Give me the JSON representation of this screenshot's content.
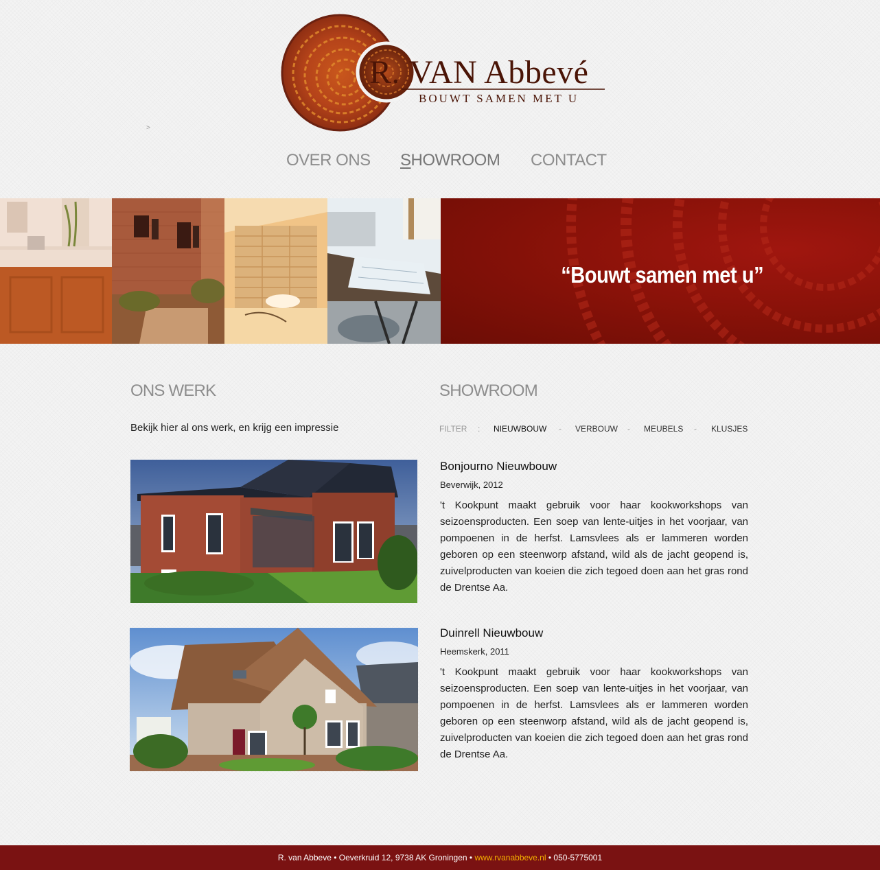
{
  "brand": {
    "logo_initial": "R.",
    "logo_name": "VAN Abbevé",
    "tagline": "BOUWT SAMEN MET U",
    "colors": {
      "primary": "#7a1212",
      "accent": "#f5b100",
      "logo_brown": "#4a1406"
    }
  },
  "breadcrumb": ">",
  "nav": {
    "items": [
      {
        "label": "OVER ONS",
        "underlined": "",
        "rest": "OVER ONS",
        "active": false
      },
      {
        "label": "SHOWROOM",
        "underlined": "S",
        "rest": "HOWROOM",
        "active": true
      },
      {
        "label": "CONTACT",
        "underlined": "",
        "rest": "CONTACT",
        "active": false
      }
    ]
  },
  "banner": {
    "quote": "“Bouwt samen met u”",
    "photos": [
      "bathroom-photo",
      "brick-house-garden-photo",
      "attic-renovation-photo",
      "desk-blueprints-photo"
    ]
  },
  "left": {
    "title": "ONS WERK",
    "intro": "Bekijk hier al ons werk, en krijg een impressie"
  },
  "right": {
    "title": "SHOWROOM",
    "filter": {
      "label": "FILTER",
      "colon": ":",
      "separator": "-",
      "items": [
        "NIEUWBOUW",
        "VERBOUW",
        "MEUBELS",
        "KLUSJES"
      ],
      "active": "NIEUWBOUW"
    }
  },
  "projects": [
    {
      "title": "Bonjourno Nieuwbouw",
      "meta": "Beverwijk, 2012",
      "description": "'t Kookpunt maakt gebruik voor haar kookworkshops van seizoensproducten. Een soep van lente-uitjes in het voorjaar, van pompoenen in de herfst. Lamsvlees als er lammeren worden geboren op een steenworp afstand, wild als de jacht geopend is, zuivelproducten van koeien die zich tegoed doen aan het gras rond de Drentse Aa."
    },
    {
      "title": "Duinrell Nieuwbouw",
      "meta": "Heemskerk, 2011",
      "description": "'t Kookpunt maakt gebruik voor haar kookworkshops van seizoensproducten. Een soep van lente-uitjes in het voorjaar, van pompoenen in de herfst. Lamsvlees als er lammeren worden geboren op een steenworp afstand, wild als de jacht geopend is, zuivelproducten van koeien die zich tegoed doen aan het gras rond de Drentse Aa."
    }
  ],
  "footer": {
    "name": "R. van Abbeve",
    "bullet": "•",
    "address": "Oeverkruid 12, 9738 AK Groningen",
    "website": "www.rvanabbeve.nl",
    "phone": "050-5775001"
  }
}
